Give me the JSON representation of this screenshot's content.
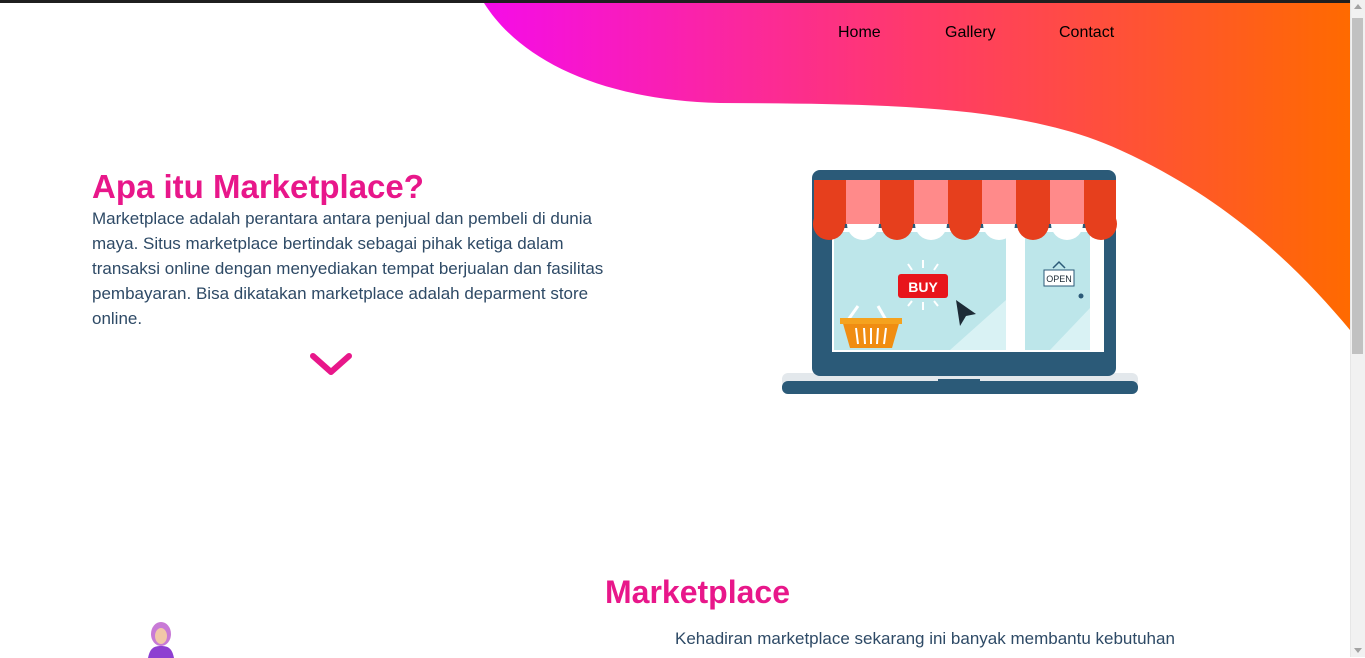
{
  "nav": {
    "home": "Home",
    "gallery": "Gallery",
    "contact": "Contact"
  },
  "hero": {
    "title": "Apa itu Marketplace?",
    "text": "Marketplace adalah perantara antara penjual dan pembeli di dunia maya. Situs marketplace bertindak sebagai pihak ketiga dalam transaksi online dengan menyediakan tempat berjualan dan fasilitas pembayaran. Bisa dikatakan marketplace adalah deparment store online.",
    "illustration": {
      "buy_label": "BUY",
      "open_label": "OPEN"
    }
  },
  "section": {
    "title": "Marketplace",
    "text": "Kehadiran marketplace sekarang ini banyak membantu kebutuhan"
  },
  "colors": {
    "accent": "#e8178a",
    "gradient_start": "#f50ce8",
    "gradient_mid": "#ff3a6a",
    "gradient_end": "#ff6a00",
    "text": "#2e4a66"
  },
  "icons": {
    "scroll_down": "chevron-down-icon"
  }
}
